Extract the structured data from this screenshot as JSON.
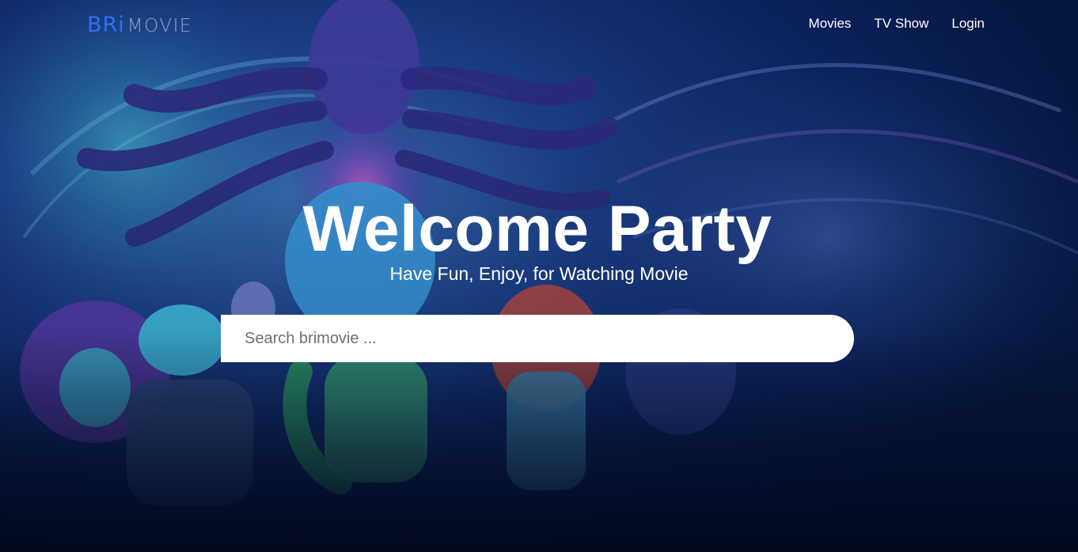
{
  "brand": {
    "logo_primary": "BRi",
    "logo_secondary": "MOVIE"
  },
  "nav": {
    "items": [
      {
        "label": "Movies"
      },
      {
        "label": "TV Show"
      },
      {
        "label": "Login"
      }
    ]
  },
  "hero": {
    "title": "Welcome Party",
    "subtitle": "Have Fun, Enjoy, for Watching Movie",
    "background": "animated-characters-poster-image"
  },
  "search": {
    "placeholder": "Search brimovie ...",
    "value": ""
  },
  "colors": {
    "page_background": "#061233",
    "logo_accent": "#2f6ff5",
    "text": "#ffffff"
  }
}
